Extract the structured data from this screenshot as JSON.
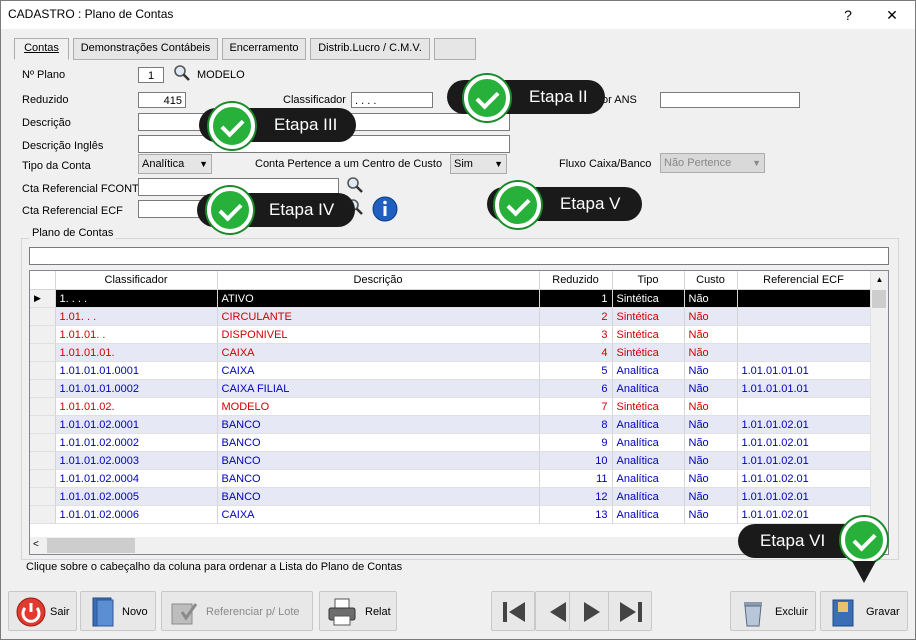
{
  "window": {
    "title": "CADASTRO : Plano de Contas",
    "help": "?",
    "close": "✕"
  },
  "tabs": [
    {
      "label": "Contas"
    },
    {
      "label": "Demonstrações Contábeis"
    },
    {
      "label": "Encerramento"
    },
    {
      "label": "Distrib.Lucro / C.M.V."
    },
    {
      "label": ""
    }
  ],
  "form": {
    "plano_label": "Nº Plano",
    "plano_value": "1",
    "plano_name": "MODELO",
    "reduzido_label": "Reduzido",
    "reduzido_value": "415",
    "classificador_label": "Classificador",
    "classificador_value": ". . . .",
    "ans_label": "or ANS",
    "ans_value": "",
    "descricao_label": "Descrição",
    "descricao_value": "",
    "descricao_ingles_label": "Descrição Inglês",
    "descricao_ingles_value": "",
    "tipo_label": "Tipo da Conta",
    "tipo_value": "Analítica",
    "centro_label": "Conta Pertence a um Centro de Custo",
    "centro_value": "Sim",
    "fluxo_label": "Fluxo Caixa/Banco",
    "fluxo_value": "Não Pertence",
    "fcont_label": "Cta Referencial FCONT",
    "fcont_value": "",
    "ecf_label": "Cta Referencial ECF",
    "ecf_value": ""
  },
  "grid": {
    "group_label": "Plano de Contas",
    "filter_value": "",
    "columns": [
      "Classificador",
      "Descrição",
      "Reduzido",
      "Tipo",
      "Custo",
      "Referencial ECF"
    ],
    "rows": [
      {
        "classificador": "1. . . .",
        "descricao": "ATIVO",
        "reduzido": "1",
        "tipo": "Sintética",
        "custo": "Não",
        "ecf": "",
        "kind": "sel"
      },
      {
        "classificador": "1.01. . .",
        "descricao": "CIRCULANTE",
        "reduzido": "2",
        "tipo": "Sintética",
        "custo": "Não",
        "ecf": "",
        "kind": "s"
      },
      {
        "classificador": "1.01.01. .",
        "descricao": "DISPONIVEL",
        "reduzido": "3",
        "tipo": "Sintética",
        "custo": "Não",
        "ecf": "",
        "kind": "s"
      },
      {
        "classificador": "1.01.01.01.",
        "descricao": "CAIXA",
        "reduzido": "4",
        "tipo": "Sintética",
        "custo": "Não",
        "ecf": "",
        "kind": "s"
      },
      {
        "classificador": "1.01.01.01.0001",
        "descricao": "CAIXA",
        "reduzido": "5",
        "tipo": "Analítica",
        "custo": "Não",
        "ecf": "1.01.01.01.01",
        "kind": "a"
      },
      {
        "classificador": "1.01.01.01.0002",
        "descricao": "CAIXA FILIAL",
        "reduzido": "6",
        "tipo": "Analítica",
        "custo": "Não",
        "ecf": "1.01.01.01.01",
        "kind": "a"
      },
      {
        "classificador": "1.01.01.02.",
        "descricao": "MODELO",
        "reduzido": "7",
        "tipo": "Sintética",
        "custo": "Não",
        "ecf": "",
        "kind": "s"
      },
      {
        "classificador": "1.01.01.02.0001",
        "descricao": "BANCO",
        "reduzido": "8",
        "tipo": "Analítica",
        "custo": "Não",
        "ecf": "1.01.01.02.01",
        "kind": "a"
      },
      {
        "classificador": "1.01.01.02.0002",
        "descricao": "BANCO",
        "reduzido": "9",
        "tipo": "Analítica",
        "custo": "Não",
        "ecf": "1.01.01.02.01",
        "kind": "a"
      },
      {
        "classificador": "1.01.01.02.0003",
        "descricao": "BANCO",
        "reduzido": "10",
        "tipo": "Analítica",
        "custo": "Não",
        "ecf": "1.01.01.02.01",
        "kind": "a"
      },
      {
        "classificador": "1.01.01.02.0004",
        "descricao": "BANCO",
        "reduzido": "11",
        "tipo": "Analítica",
        "custo": "Não",
        "ecf": "1.01.01.02.01",
        "kind": "a"
      },
      {
        "classificador": "1.01.01.02.0005",
        "descricao": "BANCO",
        "reduzido": "12",
        "tipo": "Analítica",
        "custo": "Não",
        "ecf": "1.01.01.02.01",
        "kind": "a"
      },
      {
        "classificador": "1.01.01.02.0006",
        "descricao": "CAIXA",
        "reduzido": "13",
        "tipo": "Analítica",
        "custo": "Não",
        "ecf": "1.01.01.02.01",
        "kind": "a"
      }
    ],
    "hint": "Clique sobre o cabeçalho da coluna para ordenar a Lista do Plano de Contas"
  },
  "buttons": {
    "sair": "Sair",
    "novo": "Novo",
    "referenciar": "Referenciar p/ Lote",
    "relat": "Relat",
    "excluir": "Excluir",
    "gravar": "Gravar"
  },
  "callouts": {
    "etapa2": "Etapa II",
    "etapa3": "Etapa III",
    "etapa4": "Etapa IV",
    "etapa5": "Etapa V",
    "etapa6": "Etapa VI"
  },
  "colors": {
    "synthetic": "#d00000",
    "analytic": "#0000c0",
    "check": "#27b03a"
  }
}
